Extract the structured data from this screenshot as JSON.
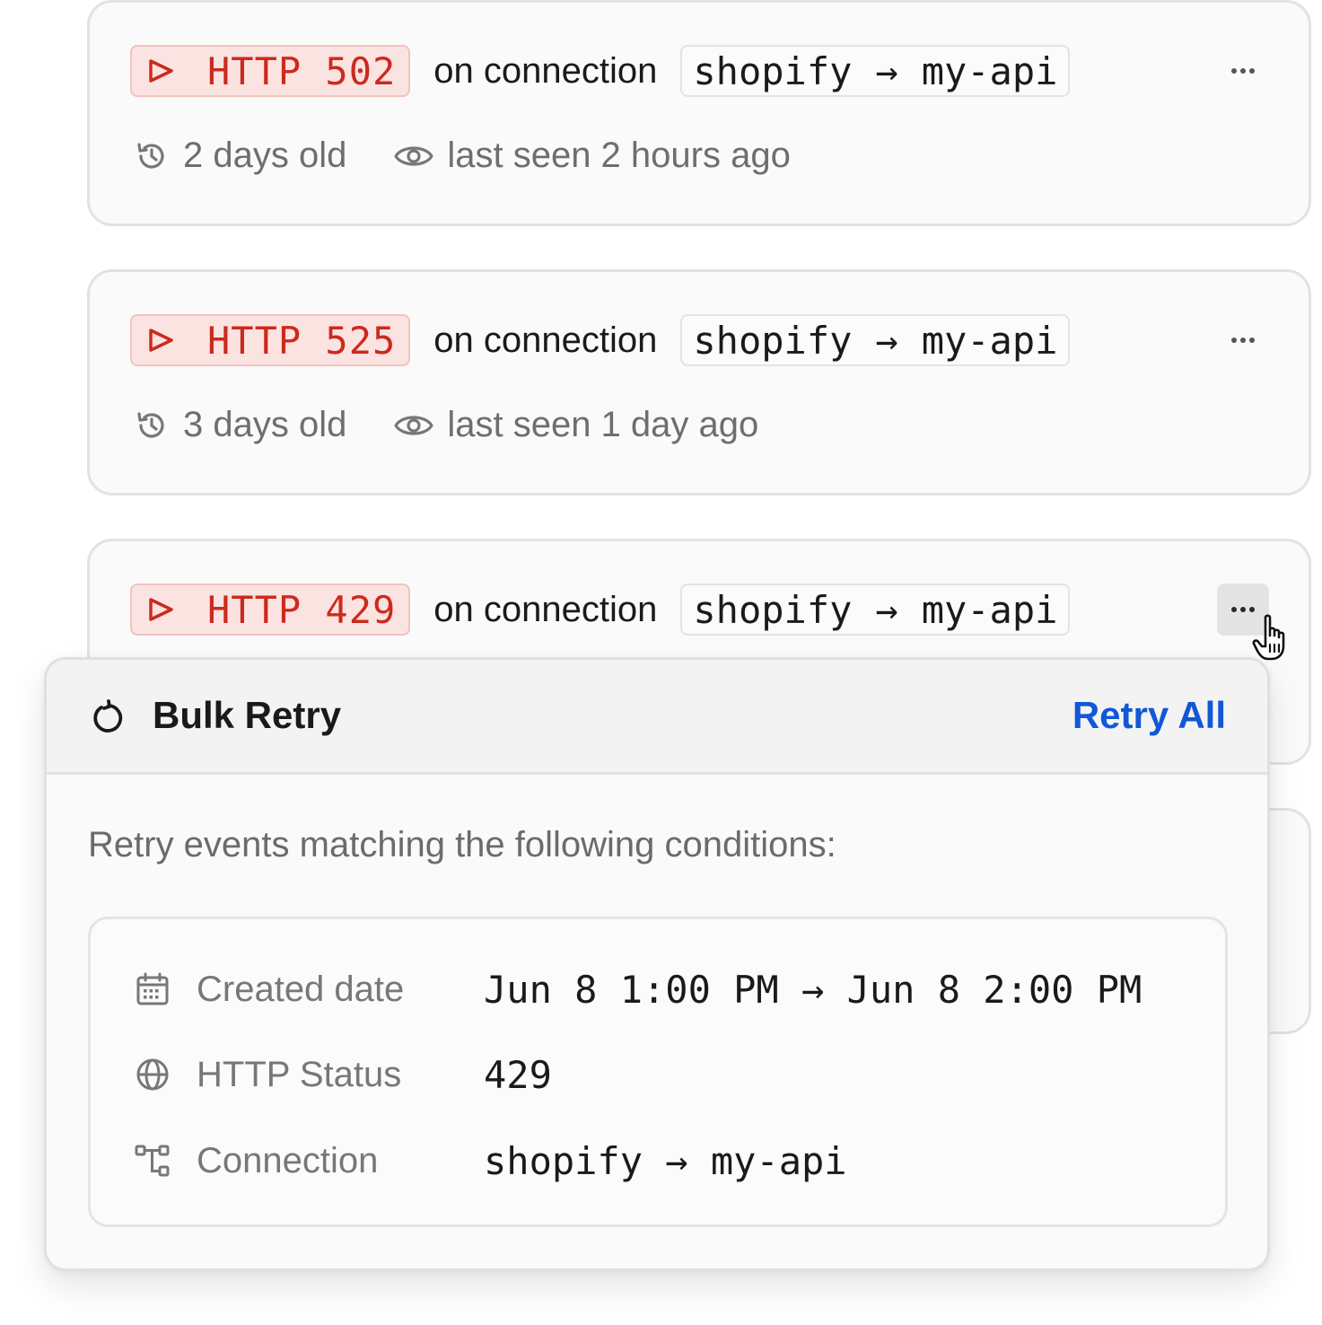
{
  "events": [
    {
      "code": "HTTP 502",
      "on_label": "on connection",
      "source": "shopify",
      "arrow": "→",
      "destination": "my-api",
      "age": "2 days old",
      "last_seen": "last seen 2 hours ago"
    },
    {
      "code": "HTTP 525",
      "on_label": "on connection",
      "source": "shopify",
      "arrow": "→",
      "destination": "my-api",
      "age": "3 days old",
      "last_seen": "last seen 1 day ago"
    },
    {
      "code": "HTTP 429",
      "on_label": "on connection",
      "source": "shopify",
      "arrow": "→",
      "destination": "my-api"
    }
  ],
  "popover": {
    "title": "Bulk Retry",
    "action": "Retry All",
    "description": "Retry events matching the following conditions:",
    "conditions": [
      {
        "icon": "calendar-icon",
        "label": "Created date",
        "value": "Jun 8 1:00 PM → Jun 8 2:00 PM"
      },
      {
        "icon": "globe-icon",
        "label": "HTTP Status",
        "value": "429"
      },
      {
        "icon": "connection-icon",
        "label": "Connection",
        "value": "shopify → my-api"
      }
    ]
  },
  "colors": {
    "error_badge_bg": "#fbe3e1",
    "error_text": "#cc2a1d",
    "link_blue": "#1257d6"
  }
}
